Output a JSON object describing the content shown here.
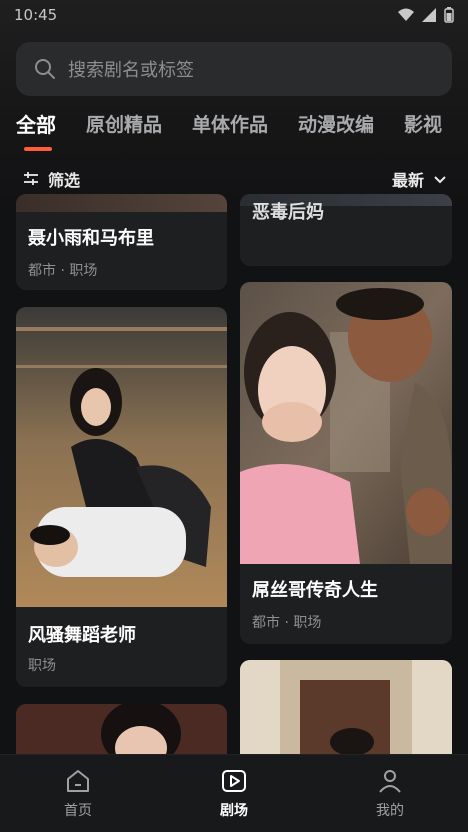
{
  "status": {
    "time": "10:45"
  },
  "search": {
    "placeholder": "搜索剧名或标签"
  },
  "tabs": [
    {
      "label": "全部",
      "active": true
    },
    {
      "label": "原创精品"
    },
    {
      "label": "单体作品"
    },
    {
      "label": "动漫改编"
    },
    {
      "label": "影视"
    }
  ],
  "filter": {
    "label": "筛选",
    "sort_label": "最新"
  },
  "cards": [
    {
      "title": "聂小雨和马布里",
      "meta": "都市 · 职场"
    },
    {
      "title": "恶毒后妈",
      "meta": ""
    },
    {
      "title": "风骚舞蹈老师",
      "meta": "职场"
    },
    {
      "title": "屌丝哥传奇人生",
      "meta": "都市 · 职场"
    }
  ],
  "nav": [
    {
      "label": "首页",
      "icon": "home-icon"
    },
    {
      "label": "剧场",
      "icon": "play-box-icon",
      "active": true
    },
    {
      "label": "我的",
      "icon": "person-icon"
    }
  ],
  "colors": {
    "accent": "#ff5c39",
    "background": "#111214",
    "card": "#1e1f21"
  }
}
